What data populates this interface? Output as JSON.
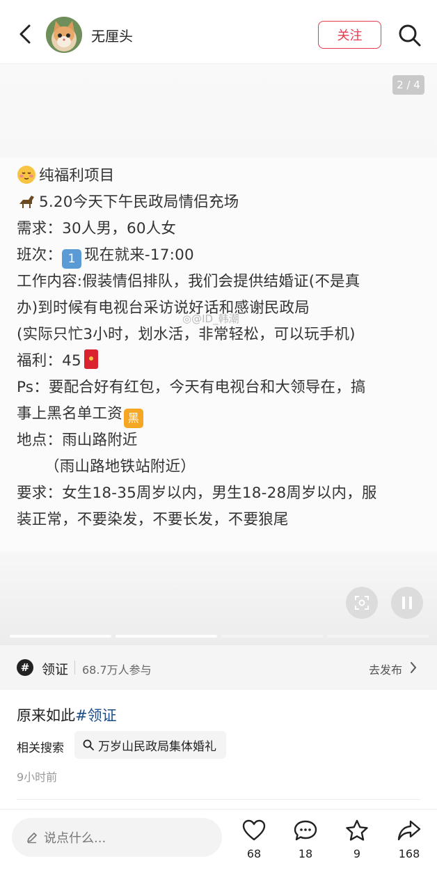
{
  "header": {
    "username": "无厘头",
    "follow_label": "关注"
  },
  "carousel": {
    "page_counter": "2 / 4",
    "slide_count": 4,
    "current_slide": 2,
    "notice_lines": [
      "纯福利项目",
      "5.20今天下午民政局情侣充场",
      "需求：30人男，60人女",
      "现在就来-17:00",
      "工作内容:假装情侣排队，我们会提供结婚证(不是真",
      "办)到时候有电视台采访说好话和感谢民政局",
      "(实际只忙3小时，划水活，非常轻松，可以玩手机)",
      "福利：45",
      "Ps：要配合好有红包，今天有电视台和大领导在，搞",
      "事上黑名单工资",
      "地点：雨山路附近",
      "（雨山路地铁站附近）",
      "要求：女生18-35周岁以内，男生18-28周岁以内，服",
      "装正常，不要染发，不要长发，不要狼尾"
    ],
    "shift_prefix": "班次：",
    "shift_number": "1",
    "black_badge": "黑",
    "watermark": "@ID_韩潮"
  },
  "topic": {
    "icon_glyph": "#",
    "name": "领证",
    "participants": "68.7万人参与",
    "publish_label": "去发布"
  },
  "post": {
    "caption_text": "原来如此",
    "caption_tag": "#领证",
    "related_label": "相关搜索",
    "related_query": "万岁山民政局集体婚礼",
    "time_ago": "9小时前"
  },
  "bottom_bar": {
    "comment_placeholder": "说点什么...",
    "likes": "68",
    "comments": "18",
    "favorites": "9",
    "shares": "168"
  },
  "colors": {
    "accent_red": "#e8394d",
    "tag_blue": "#1a4e8a"
  }
}
